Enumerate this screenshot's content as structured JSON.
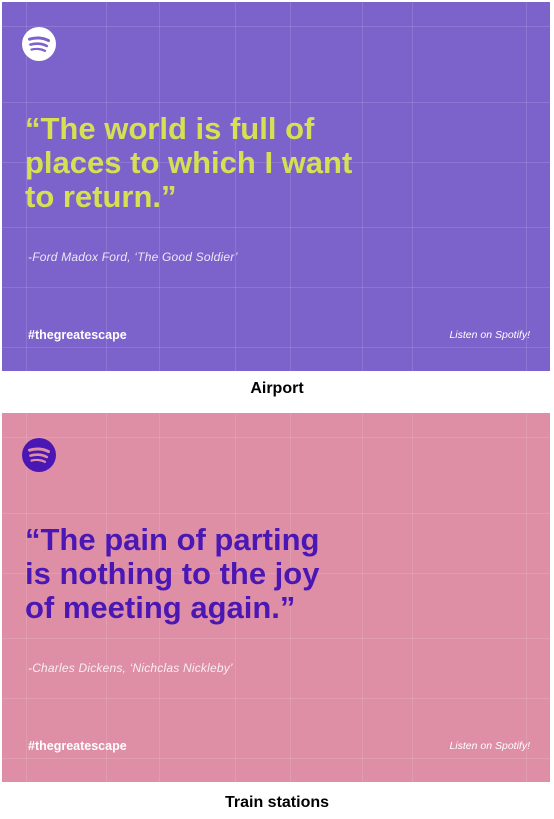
{
  "colors": {
    "card1_background": "#7c62cb",
    "card1_quote": "#d6e052",
    "card2_background": "#de8ea5",
    "card2_quote": "#4a17b5",
    "logo_card1": "#ffffff",
    "logo_card2": "#4a17b5"
  },
  "cards": [
    {
      "icon": "spotify-logo-icon",
      "quote_lines": [
        "“The world is full of",
        "places to which I want",
        "to return.”"
      ],
      "attribution": "-Ford Madox Ford, ‘The Good Soldier’",
      "hashtag": "#thegreatescape",
      "listen": "Listen on Spotify!",
      "caption": "Airport"
    },
    {
      "icon": "spotify-logo-icon",
      "quote_lines": [
        "“The pain of parting",
        "is nothing to the joy",
        "of meeting again.”"
      ],
      "attribution": "-Charles Dickens, ‘Nichclas Nickleby’",
      "hashtag": "#thegreatescape",
      "listen": "Listen on Spotify!",
      "caption": "Train stations"
    }
  ]
}
